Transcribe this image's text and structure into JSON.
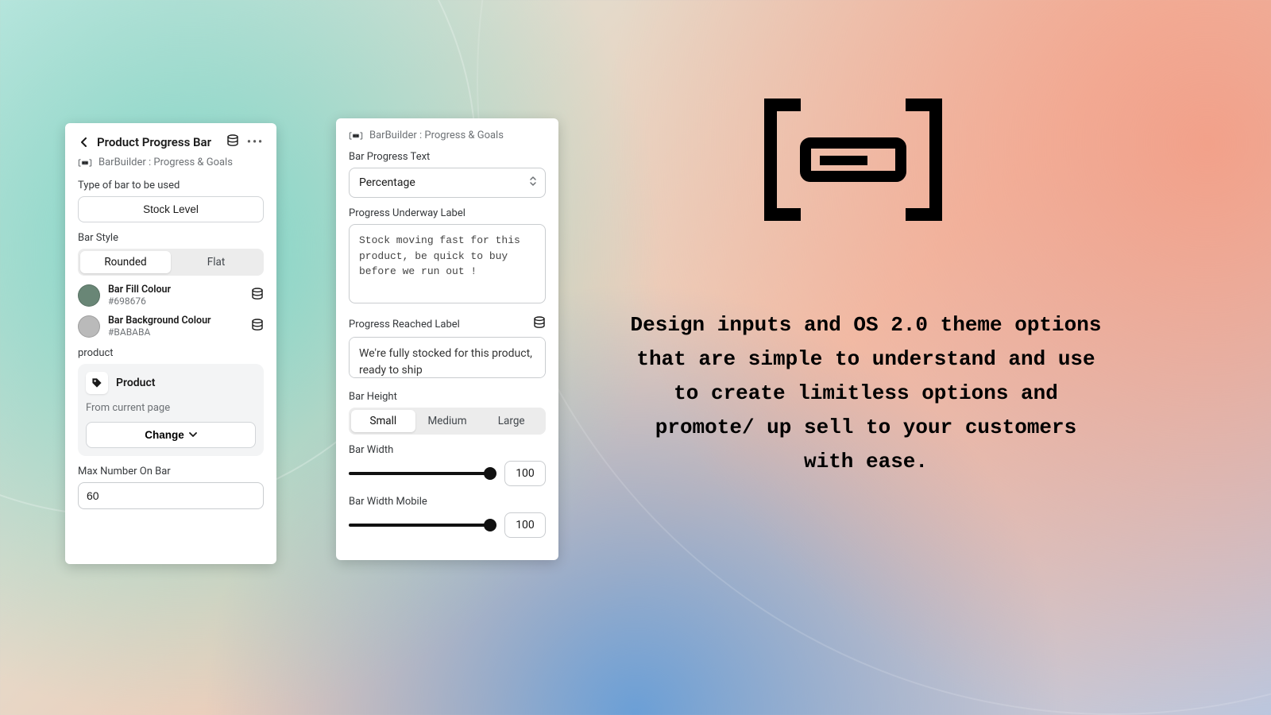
{
  "left": {
    "title": "Product Progress Bar",
    "sub": "BarBuilder : Progress & Goals",
    "type_label": "Type of bar to be used",
    "type_value": "Stock Level",
    "style_label": "Bar Style",
    "style_options": [
      "Rounded",
      "Flat"
    ],
    "style_active": 0,
    "fill": {
      "name": "Bar Fill Colour",
      "hex": "#698676"
    },
    "bg": {
      "name": "Bar Background Colour",
      "hex": "#BABABA"
    },
    "product_label": "product",
    "product_title": "Product",
    "product_sub": "From current page",
    "change": "Change",
    "max_label": "Max Number On Bar",
    "max_value": "60"
  },
  "right": {
    "sub": "BarBuilder : Progress & Goals",
    "ptext_label": "Bar Progress Text",
    "ptext_value": "Percentage",
    "underway_label": "Progress Underway Label",
    "underway_value": "Stock moving fast for this product, be quick to buy before we run out !",
    "reached_label": "Progress Reached Label",
    "reached_value": "We're fully stocked for this product, ready to ship",
    "height_label": "Bar Height",
    "height_options": [
      "Small",
      "Medium",
      "Large"
    ],
    "height_active": 0,
    "width_label": "Bar Width",
    "width_value": "100",
    "width_m_label": "Bar Width Mobile",
    "width_m_value": "100"
  },
  "copy": "Design inputs and OS 2.0 theme options that are simple to understand and use to create limitless options and promote/ up sell to your customers with ease."
}
